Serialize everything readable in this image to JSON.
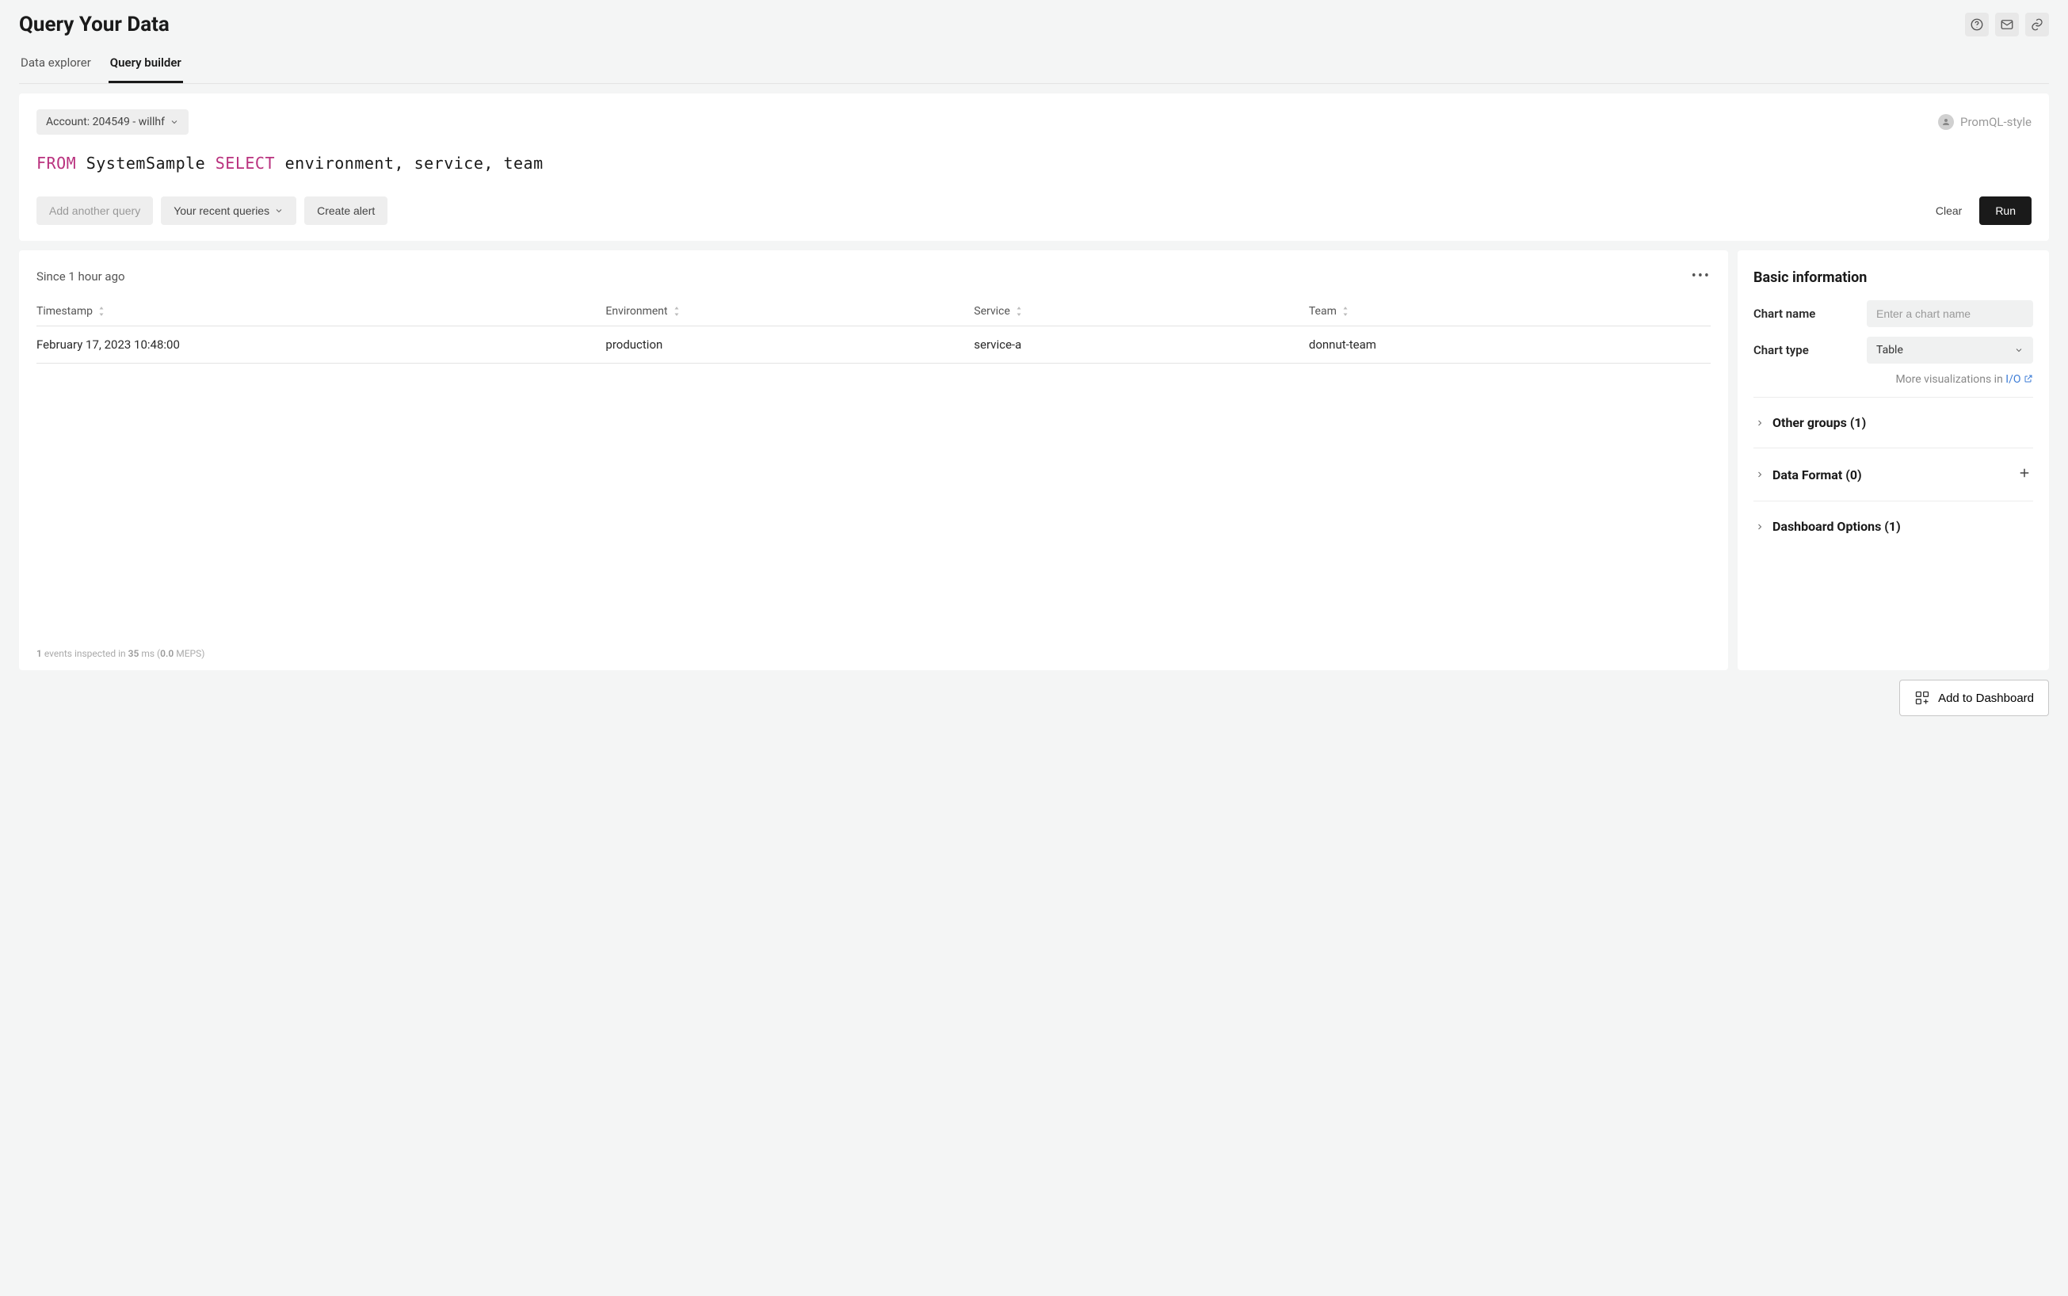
{
  "header": {
    "title": "Query Your Data"
  },
  "tabs": {
    "data_explorer": "Data explorer",
    "query_builder": "Query builder"
  },
  "query": {
    "account_label": "Account: 204549 - willhf",
    "style_badge": "PromQL-style",
    "query_string": {
      "kw_from": "FROM",
      "table": "SystemSample",
      "kw_select": "SELECT",
      "fields": " environment, service, team"
    },
    "buttons": {
      "add_query": "Add another query",
      "recent_queries": "Your recent queries",
      "create_alert": "Create alert",
      "clear": "Clear",
      "run": "Run"
    }
  },
  "results": {
    "since": "Since 1 hour ago",
    "columns": {
      "timestamp": "Timestamp",
      "environment": "Environment",
      "service": "Service",
      "team": "Team"
    },
    "rows": [
      {
        "timestamp": "February 17, 2023 10:48:00",
        "environment": "production",
        "service": "service-a",
        "team": "donnut-team"
      }
    ],
    "footer": {
      "events_count": "1",
      "text_a": " events inspected in ",
      "ms": "35",
      "text_b": " ms (",
      "meps": "0.0",
      "text_c": " MEPS)"
    }
  },
  "sidebar": {
    "basic_info_title": "Basic information",
    "chart_name_label": "Chart name",
    "chart_name_placeholder": "Enter a chart name",
    "chart_type_label": "Chart type",
    "chart_type_value": "Table",
    "more_viz_text": "More visualizations in ",
    "more_viz_link": "I/O",
    "accordion": {
      "other_groups": "Other groups (1)",
      "data_format": "Data Format (0)",
      "dashboard_options": "Dashboard Options (1)"
    }
  },
  "footer_button": "Add to Dashboard"
}
